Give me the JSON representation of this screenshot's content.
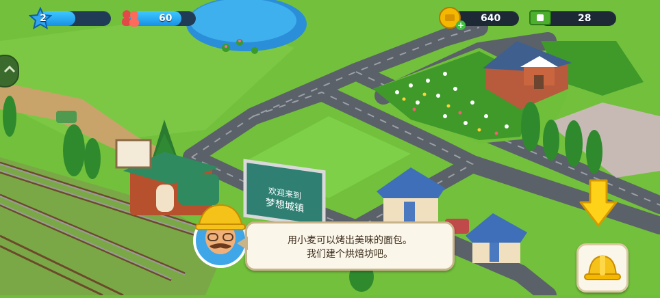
{
  "hud": {
    "level": "2",
    "xp_progress": 0.5,
    "population": "60",
    "coins": "640",
    "cash": "28"
  },
  "billboard": {
    "line1": "欢迎来到",
    "line2": "梦想城镇"
  },
  "dialog": {
    "line1": "用小麦可以烤出美味的面包。",
    "line2": "我们建个烘焙坊吧。"
  },
  "icons": {
    "level": "star-icon",
    "population": "people-icon",
    "coins": "coin-icon",
    "cash": "cash-icon",
    "hint": "down-arrow-icon",
    "build": "hard-hat-icon"
  },
  "colors": {
    "grass": "#6fbf3a",
    "road": "#5b6168",
    "hud_blue": "#1a8fe6",
    "coin_gold": "#f5b800",
    "cash_green": "#4caf2e"
  }
}
